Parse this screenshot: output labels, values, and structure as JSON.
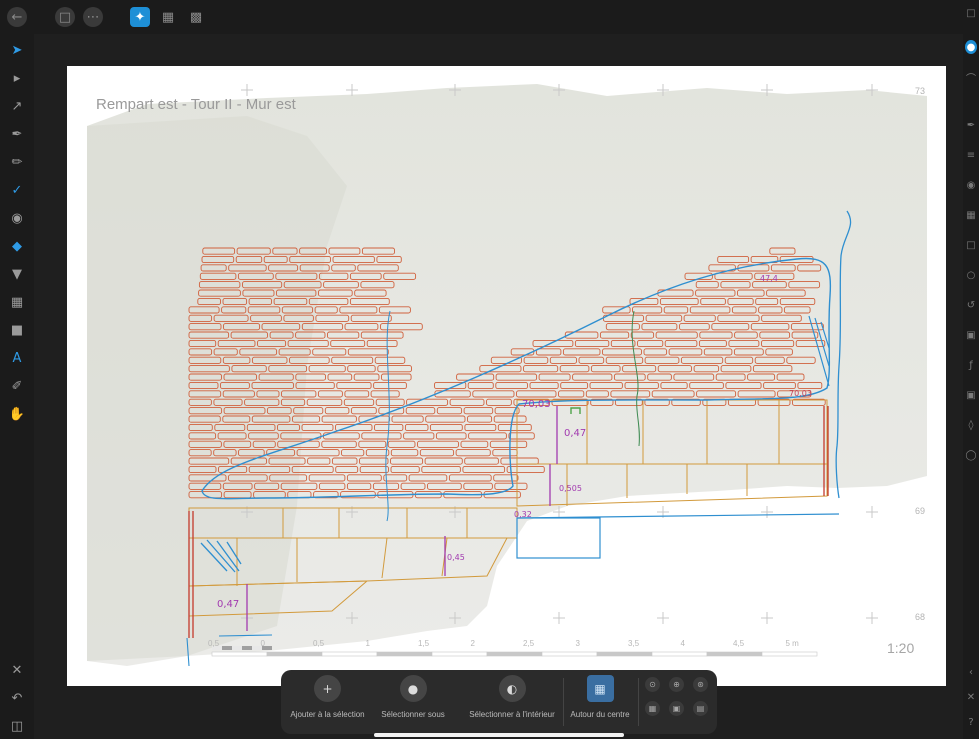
{
  "document": {
    "title": "Rempart est - Tour II - Mur est",
    "scale_ratio": "1:20",
    "scale_labels": [
      "0,5",
      "0",
      "0,5",
      "1",
      "1,5",
      "2",
      "2,5",
      "3",
      "3,5",
      "4",
      "4,5",
      "5 m"
    ],
    "levels": [
      "73",
      "69",
      "68"
    ],
    "annotations": [
      "70,03",
      "0,47",
      "0,505",
      "0,32",
      "0,45",
      "0,47",
      "70,03",
      "47,4"
    ]
  },
  "context_toolbar": {
    "add_to_selection": "Ajouter à la sélection",
    "select_under": "Sélectionner sous",
    "select_inside": "Sélectionner à l'intérieur",
    "around_center": "Autour du centre"
  },
  "colors": {
    "accent": "#1e8fd6",
    "stone_outline": "#d0603c",
    "course_line": "#d29a3c",
    "contour_blue": "#2f8fd0",
    "annotation_purple": "#a23bb0",
    "vertical_red": "#c43a2c"
  }
}
